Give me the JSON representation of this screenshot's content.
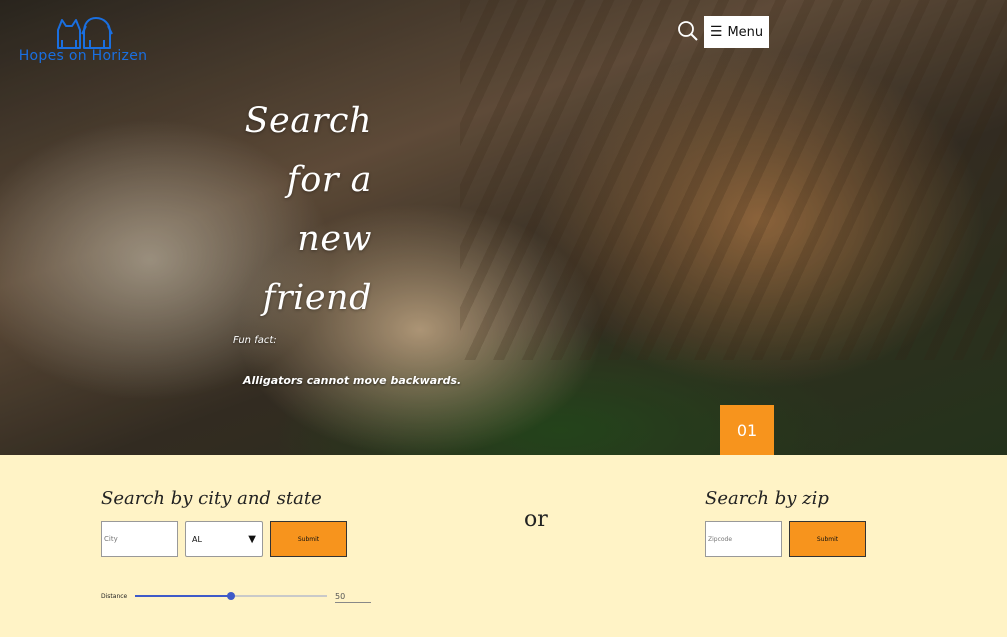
{
  "brand": {
    "name": "Hopes on Horizen",
    "color": "#1a6fe0",
    "logo_icon": "cat-and-dog-logo-icon"
  },
  "header": {
    "search_icon": "search-icon",
    "menu_icon": "hamburger-icon",
    "menu_label": "Menu"
  },
  "hero": {
    "title_lines": [
      "Search",
      "for a",
      "new",
      "friend"
    ],
    "fun_fact_label": "Fun fact:",
    "fun_fact_text": "Alligators cannot move backwards.",
    "slide_number": "01",
    "accent_color": "#f7941d"
  },
  "search": {
    "city_heading": "Search by city and state",
    "city_placeholder": "City",
    "state_selected": "AL",
    "city_submit_label": "Submit",
    "or_text": "or",
    "zip_heading": "Search by zip",
    "zip_placeholder": "Zipcode",
    "zip_submit_label": "Submit",
    "distance_label": "Distance",
    "distance_value": "50",
    "distance_fraction": 0.5
  },
  "colors": {
    "section_background": "#fff3c6",
    "button": "#f7941d",
    "slider": "#3f5ac8"
  }
}
